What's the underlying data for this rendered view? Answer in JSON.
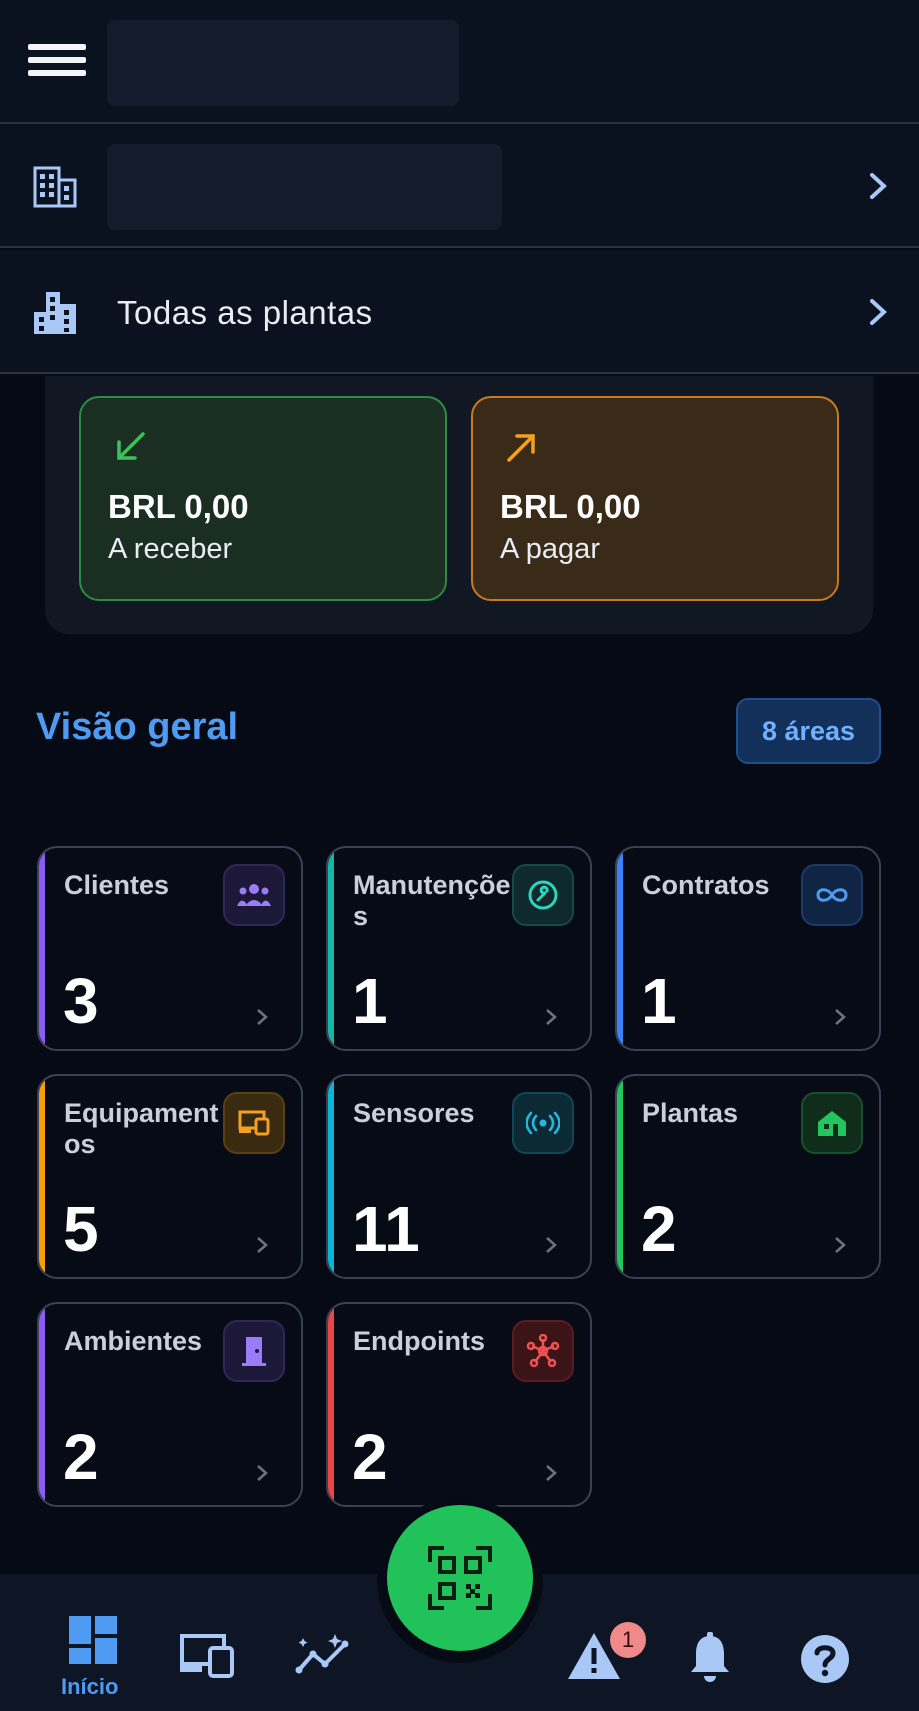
{
  "header": {
    "menu_icon": "hamburger-icon"
  },
  "company_row": {
    "icon": "office-building-icon"
  },
  "plants_row": {
    "label": "Todas as plantas",
    "icon": "city-buildings-icon"
  },
  "finance": {
    "receivable": {
      "amount": "BRL 0,00",
      "label": "A receber",
      "color": "#2f8a45"
    },
    "payable": {
      "amount": "BRL 0,00",
      "label": "A pagar",
      "color": "#c77a20"
    }
  },
  "overview": {
    "title": "Visão geral",
    "badge": "8 áreas"
  },
  "tiles": [
    {
      "name": "Clientes",
      "count": "3",
      "icon": "users-icon",
      "color": "#8a5cf6"
    },
    {
      "name": "Manutenções",
      "count": "1",
      "icon": "wrench-icon",
      "color": "#14b8a6"
    },
    {
      "name": "Contratos",
      "count": "1",
      "icon": "infinity-icon",
      "color": "#3b82f6"
    },
    {
      "name": "Equipamentos",
      "count": "5",
      "icon": "devices-icon",
      "color": "#f59e0b"
    },
    {
      "name": "Sensores",
      "count": "11",
      "icon": "sensor-icon",
      "color": "#06b6d4"
    },
    {
      "name": "Plantas",
      "count": "2",
      "icon": "house-icon",
      "color": "#22c55e"
    },
    {
      "name": "Ambientes",
      "count": "2",
      "icon": "door-icon",
      "color": "#8b5cf6"
    },
    {
      "name": "Endpoints",
      "count": "2",
      "icon": "network-icon",
      "color": "#ef4444"
    }
  ],
  "bottom_nav": {
    "home_label": "Início",
    "alerts_count": "1",
    "items": [
      "dashboard-icon",
      "devices-icon",
      "analytics-icon",
      "qr-code-icon",
      "warning-icon",
      "bell-icon",
      "help-icon"
    ]
  }
}
